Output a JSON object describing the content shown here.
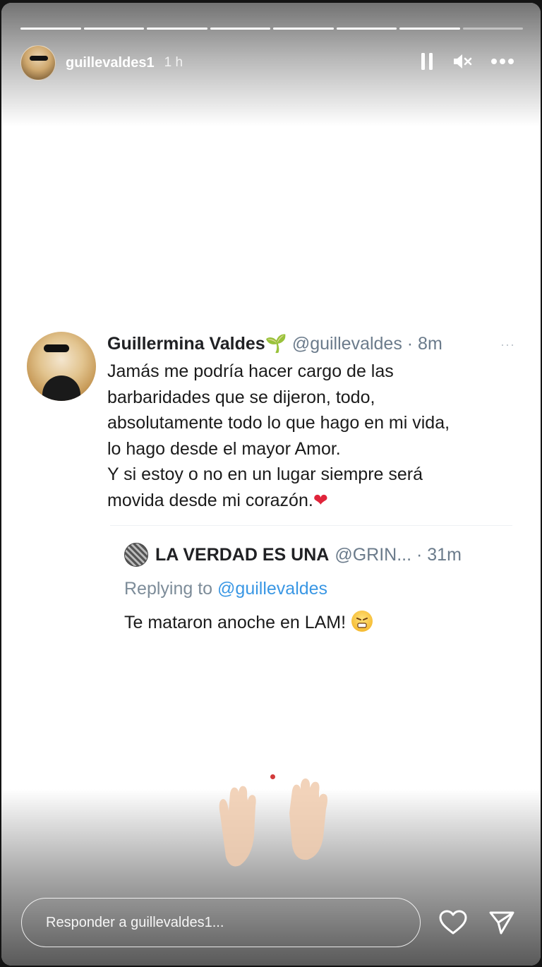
{
  "story": {
    "segments_total": 8,
    "segments_viewed": 7,
    "username": "guillevaldes1",
    "time": "1 h"
  },
  "controls": {
    "pause_icon": "pause-icon",
    "mute_icon": "muted-speaker-icon",
    "more_icon": "more-dots-icon"
  },
  "tweet": {
    "name": "Guillermina Valdes",
    "name_emoji": "🌱",
    "handle_time": "@guillevaldes · 8m",
    "more": "···",
    "lines": [
      "Jamás me podría hacer cargo de las",
      "barbaridades que se dijeron, todo,",
      "absolutamente todo lo que hago en mi vida,",
      "lo hago desde el mayor Amor.",
      "Y si estoy o no en un lugar siempre será",
      "movida desde mi corazón."
    ],
    "heart": "❤"
  },
  "quoted": {
    "name": "LA VERDAD ES UNA",
    "handle_time": "@GRIN... · 31m",
    "replying_prefix": "Replying to",
    "replying_mention": "@guillevaldes",
    "text": "Te mataron anoche en LAM!"
  },
  "footer": {
    "reply_placeholder": "Responder a guillevaldes1...",
    "like_icon": "heart-outline-icon",
    "share_icon": "send-icon"
  },
  "colors": {
    "link": "#3a97e4",
    "heart": "#e0243a",
    "muted_text": "#6b7b8b"
  }
}
